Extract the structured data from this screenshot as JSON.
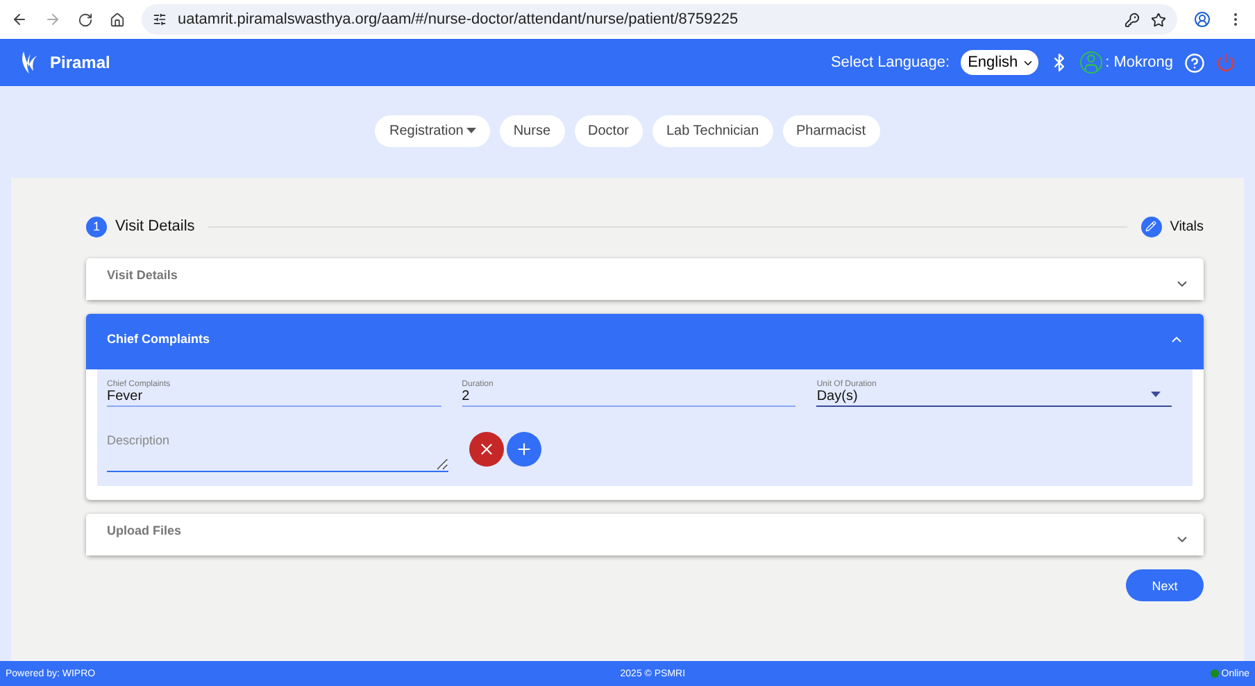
{
  "browser": {
    "url": "uatamrit.piramalswasthya.org/aam/#/nurse-doctor/attendant/nurse/patient/8759225"
  },
  "header": {
    "brand": "Piramal",
    "language_label": "Select Language:",
    "language": "English",
    "user": ": Mokrong"
  },
  "nav_tabs": [
    {
      "label": "Registration",
      "dropdown": true
    },
    {
      "label": "Nurse",
      "dropdown": false
    },
    {
      "label": "Doctor",
      "dropdown": false
    },
    {
      "label": "Lab Technician",
      "dropdown": false
    },
    {
      "label": "Pharmacist",
      "dropdown": false
    }
  ],
  "stepper": [
    {
      "kind": "number",
      "marker": "1",
      "label": "Visit Details"
    },
    {
      "kind": "edit",
      "label": "Vitals"
    }
  ],
  "panels": [
    {
      "title": "Visit Details",
      "expanded": false
    },
    {
      "title": "Chief Complaints",
      "expanded": true,
      "fields": [
        {
          "kind": "input",
          "label": "Chief Complaints",
          "value": "Fever"
        },
        {
          "kind": "input",
          "label": "Duration",
          "value": "2"
        },
        {
          "kind": "select",
          "label": "Unit Of Duration",
          "value": "Day(s)"
        }
      ],
      "description": {
        "placeholder": "Description"
      }
    },
    {
      "title": "Upload Files",
      "expanded": false
    }
  ],
  "next_button": "Next",
  "footer": {
    "left": "Powered by: WIPRO",
    "center": "2025 © PSMRI",
    "status": "Online"
  }
}
